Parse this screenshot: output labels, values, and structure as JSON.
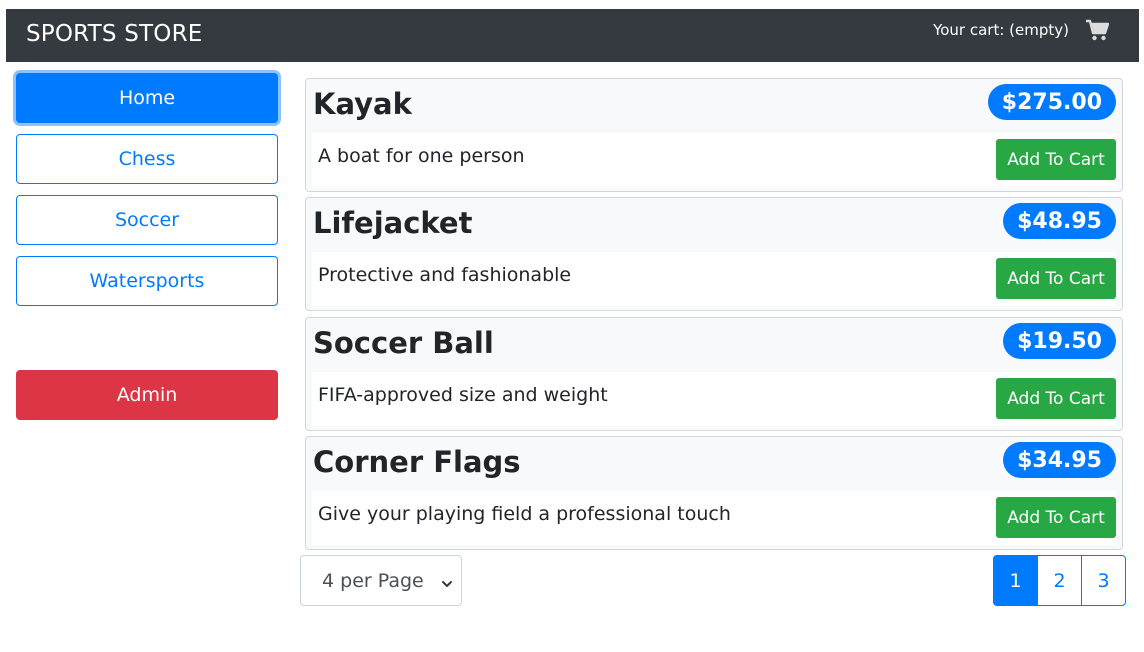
{
  "header": {
    "brand": "SPORTS STORE",
    "cart_text": "Your cart: (empty)",
    "cart_icon": "shopping-cart-icon"
  },
  "sidebar": {
    "categories": [
      {
        "label": "Home",
        "active": true
      },
      {
        "label": "Chess",
        "active": false
      },
      {
        "label": "Soccer",
        "active": false
      },
      {
        "label": "Watersports",
        "active": false
      }
    ],
    "admin_label": "Admin"
  },
  "products": [
    {
      "name": "Kayak",
      "price": "$275.00",
      "description": "A boat for one person",
      "button": "Add To Cart"
    },
    {
      "name": "Lifejacket",
      "price": "$48.95",
      "description": "Protective and fashionable",
      "button": "Add To Cart"
    },
    {
      "name": "Soccer Ball",
      "price": "$19.50",
      "description": "FIFA-approved size and weight",
      "button": "Add To Cart"
    },
    {
      "name": "Corner Flags",
      "price": "$34.95",
      "description": "Give your playing field a professional touch",
      "button": "Add To Cart"
    }
  ],
  "pagination": {
    "page_size_label": "4 per Page",
    "pages": [
      "1",
      "2",
      "3"
    ],
    "current_page": "1"
  },
  "colors": {
    "primary": "#007bff",
    "success": "#28a745",
    "danger": "#dc3545",
    "navbar": "#343a40"
  }
}
